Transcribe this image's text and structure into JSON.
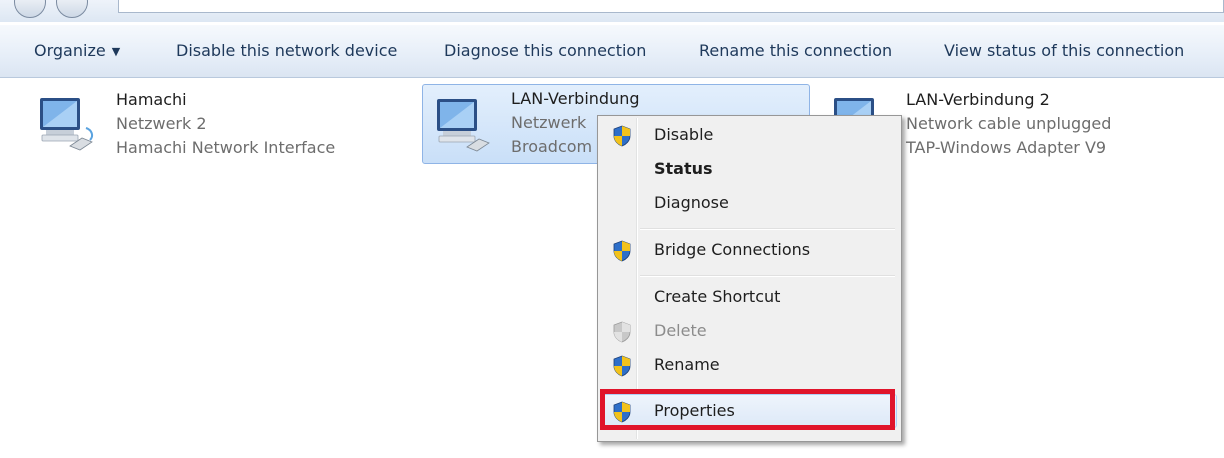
{
  "toolbar": {
    "organize": "Organize",
    "disable_device": "Disable this network device",
    "diagnose": "Diagnose this connection",
    "rename": "Rename this connection",
    "view_status": "View status of this connection"
  },
  "connections": [
    {
      "name": "Hamachi",
      "status": "Netzwerk  2",
      "adapter": "Hamachi Network Interface",
      "icon": "network-adapter-icon"
    },
    {
      "name": "LAN-Verbindung",
      "status": "Netzwerk",
      "adapter": "Broadcom",
      "icon": "network-adapter-icon",
      "selected": true
    },
    {
      "name": "LAN-Verbindung 2",
      "status": "Network cable unplugged",
      "adapter": "TAP-Windows Adapter V9",
      "icon": "network-adapter-icon"
    }
  ],
  "context_menu": {
    "items": [
      {
        "label": "Disable",
        "shield": true
      },
      {
        "label": "Status",
        "bold": true
      },
      {
        "label": "Diagnose"
      },
      {
        "label": "Bridge Connections",
        "shield": true
      },
      {
        "label": "Create Shortcut"
      },
      {
        "label": "Delete",
        "shield": true,
        "disabled": true
      },
      {
        "label": "Rename",
        "shield": true
      },
      {
        "label": "Properties",
        "shield": true,
        "highlighted": true
      }
    ]
  },
  "colors": {
    "highlight_box": "#e0142b",
    "selection": "#c9dff8",
    "command_text": "#1e395b"
  }
}
